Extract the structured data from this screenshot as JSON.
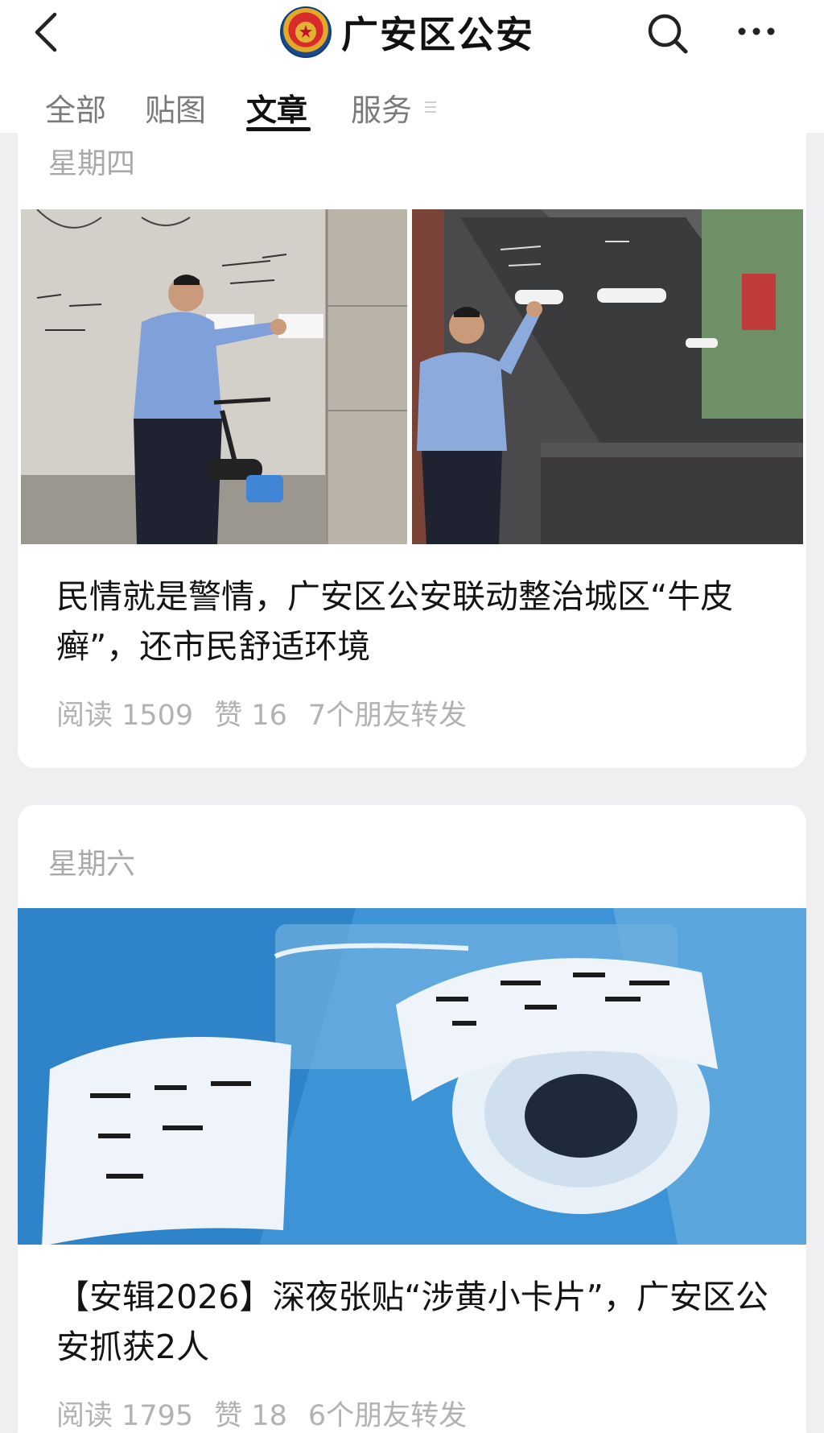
{
  "header": {
    "title": "广安区公安",
    "icons": [
      "back-arrow-icon",
      "police-emblem-icon",
      "search-icon",
      "more-icon"
    ]
  },
  "tabs": [
    {
      "label": "全部",
      "active": false
    },
    {
      "label": "贴图",
      "active": false
    },
    {
      "label": "文章",
      "active": true
    },
    {
      "label": "服务",
      "active": false
    }
  ],
  "articles": [
    {
      "day": "星期四",
      "title": "民情就是警情，广安区公安联动整治城区“牛皮癣”，还市民舒适环境",
      "reads_label": "阅读 1509",
      "likes_label": "赞 16",
      "shares_label": "7个朋友转发"
    },
    {
      "day": "星期六",
      "title": "【安辑2026】深夜张贴“涉黄小卡片”，广安区公安抓获2人",
      "reads_label": "阅读 1795",
      "likes_label": "赞 18",
      "shares_label": "6个朋友转发"
    }
  ],
  "colors": {
    "page_bg": "#efeff1",
    "card_bg": "#ffffff",
    "meta_text": "#b2b2b2",
    "tab_inactive": "#7a7a7a",
    "tab_active": "#111111"
  }
}
